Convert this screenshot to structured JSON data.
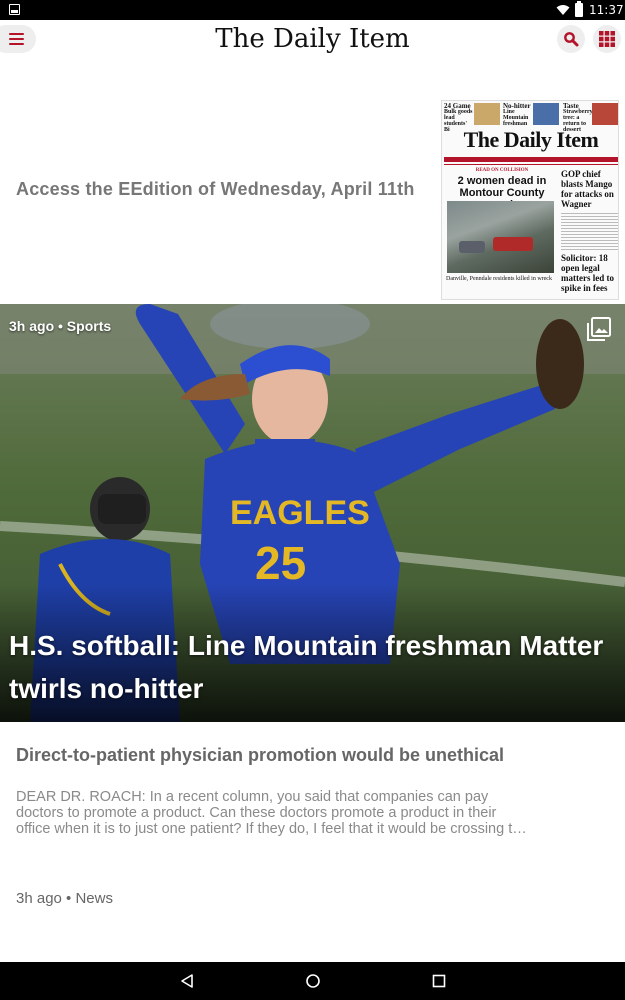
{
  "status_bar": {
    "time": "11:37"
  },
  "header": {
    "logo": "The Daily Item"
  },
  "eedition": {
    "text": "Access the EEdition of Wednesday, April 11th",
    "thumbnail": {
      "masthead": "The Daily Item",
      "promos": [
        {
          "head": "24 Game",
          "sub": "Bulk goods lead students' Bi"
        },
        {
          "head": "No-hitter",
          "sub": "Line Mountain freshman"
        },
        {
          "head": "Taste",
          "sub": "Strawberry tree: a return to dessert"
        }
      ],
      "kicker": "READ ON COLLISION",
      "lead_headline": "2 women dead in Montour County crash",
      "photo_caption": "Danville, Penndale residents killed in wreck",
      "side_headline_1": "GOP chief blasts Mango for attacks on Wagner",
      "side_headline_2": "Solicitor: 18 open legal matters led to spike in fees"
    }
  },
  "feature": {
    "meta": "3h ago • Sports",
    "headline": "H.S. softball: Line Mountain freshman Matter twirls no-hitter",
    "jersey_team": "EAGLES",
    "jersey_number": "25"
  },
  "article": {
    "title": "Direct-to-patient physician promotion would be unethical",
    "excerpt_lines": [
      "DEAR DR. ROACH: In a recent column, you said that companies can pay",
      "doctors to promote a product. Can these doctors promote a product in their",
      "office when it is to just one patient? If they do, I feel that it would be crossing t…"
    ],
    "meta": "3h ago • News"
  },
  "colors": {
    "brand_red": "#b3142a",
    "header_bg": "#ffffff"
  }
}
